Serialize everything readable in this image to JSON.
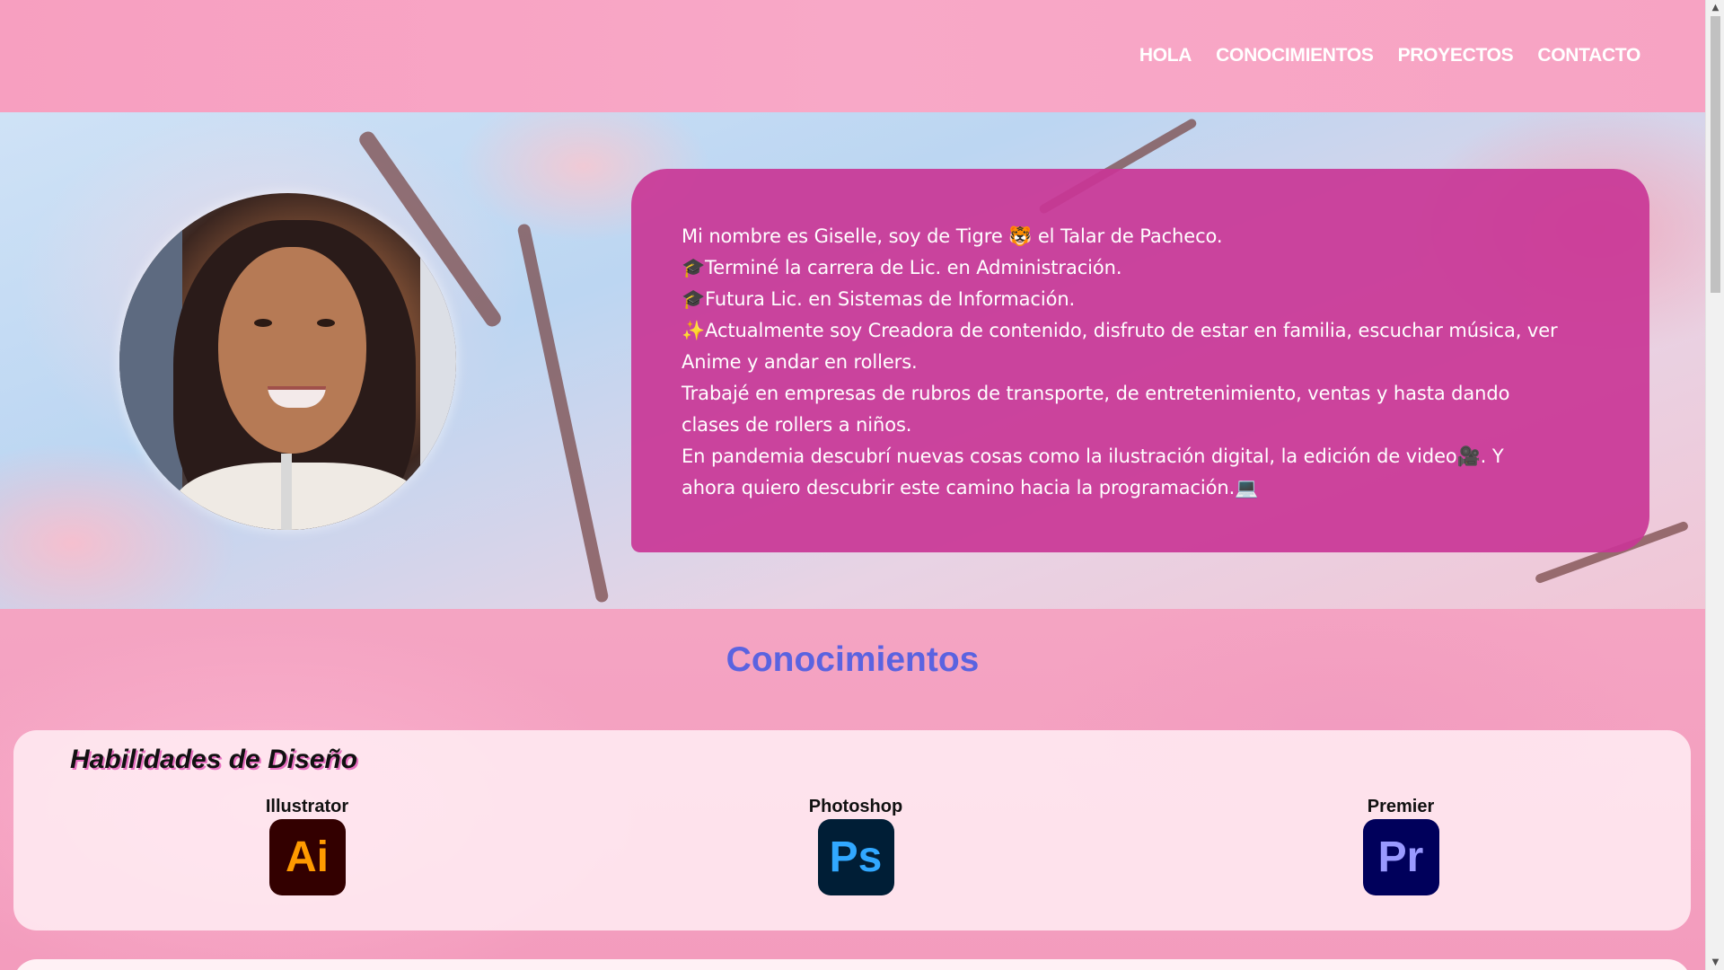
{
  "nav": {
    "items": [
      {
        "label": "HOLA"
      },
      {
        "label": "CONOCIMIENTOS"
      },
      {
        "label": "PROYECTOS"
      },
      {
        "label": "CONTACTO"
      }
    ]
  },
  "hero": {
    "bio_lines": [
      "Mi nombre es Giselle, soy de Tigre 🐯 el Talar de Pacheco.",
      "🎓Terminé la carrera de Lic. en Administración.",
      "🎓Futura Lic. en Sistemas de Información.",
      "✨Actualmente soy Creadora de contenido, disfruto de estar en familia, escuchar música, ver",
      "Anime y andar en rollers.",
      "Trabajé en empresas de rubros de transporte, de entretenimiento, ventas y hasta dando",
      "clases de rollers a niños.",
      "En pandemia descubrí nuevas cosas como la ilustración digital, la edición de video🎥. Y",
      "ahora quiero descubrir este camino hacia la programación.💻"
    ]
  },
  "conocimientos": {
    "title": "Conocimientos",
    "design_skills": {
      "heading": "Habilidades de Diseño",
      "items": [
        {
          "label": "Illustrator",
          "icon_text": "Ai",
          "icon": "illustrator-icon",
          "bg": "#330000",
          "fg": "#ff9a00"
        },
        {
          "label": "Photoshop",
          "icon_text": "Ps",
          "icon": "photoshop-icon",
          "bg": "#001e36",
          "fg": "#31a8ff"
        },
        {
          "label": "Premier",
          "icon_text": "Pr",
          "icon": "premiere-icon",
          "bg": "#00005b",
          "fg": "#9999ff"
        }
      ]
    }
  },
  "colors": {
    "nav_bg": "#f7a3c3",
    "bio_card": "#c93696",
    "section_title": "#5a63e0"
  }
}
